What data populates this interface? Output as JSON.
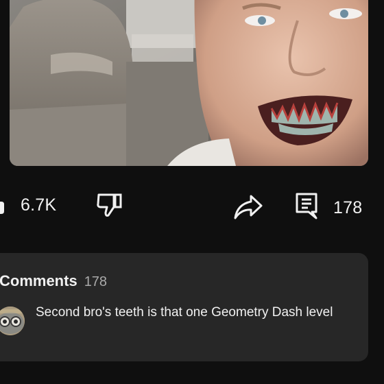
{
  "actions": {
    "like_count": "6.7K",
    "comment_count": "178"
  },
  "comments": {
    "title": "Comments",
    "count": "178",
    "top_comment": {
      "text": "Second bro's teeth is that one Geometry Dash level"
    }
  },
  "icons": {
    "like": "thumbs-up-icon",
    "dislike": "thumbs-down-icon",
    "share": "share-icon",
    "comments": "comment-icon"
  },
  "colors": {
    "background": "#0f0f0f",
    "card": "#272727",
    "text": "#f1f1f1",
    "muted": "#aaaaaa"
  }
}
